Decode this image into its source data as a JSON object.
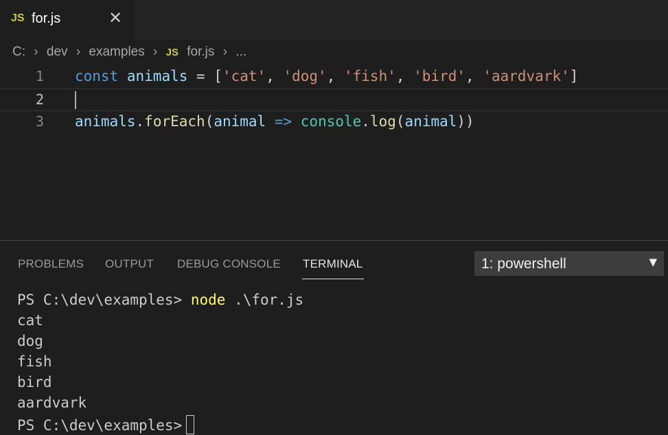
{
  "tab": {
    "badge": "JS",
    "title": "for.js",
    "close_glyph": "✕"
  },
  "breadcrumb": {
    "items": [
      "C:",
      "dev",
      "examples",
      "for.js",
      "..."
    ],
    "file_badge": "JS",
    "separator": "›"
  },
  "editor": {
    "line_numbers": [
      "1",
      "2",
      "3"
    ],
    "line1": {
      "kw": "const",
      "name": "animals",
      "eq": " = [",
      "s1": "'cat'",
      "s2": "'dog'",
      "s3": "'fish'",
      "s4": "'bird'",
      "s5": "'aardvark'",
      "comma": ", ",
      "end": "]"
    },
    "line3": {
      "obj": "animals",
      "dot": ".",
      "method": "forEach",
      "open": "(",
      "param": "animal",
      "arrow": " => ",
      "console": "console",
      "log": "log",
      "arg": "animal",
      "close": "))"
    }
  },
  "panel": {
    "tabs": [
      "PROBLEMS",
      "OUTPUT",
      "DEBUG CONSOLE",
      "TERMINAL"
    ],
    "active_tab": "TERMINAL",
    "terminal_select": {
      "value": "1: powershell",
      "arrow": "▼"
    }
  },
  "terminal": {
    "prompt": "PS C:\\dev\\examples> ",
    "command": "node",
    "args": " .\\for.js",
    "output": [
      "cat",
      "dog",
      "fish",
      "bird",
      "aardvark"
    ],
    "final_prompt": "PS C:\\dev\\examples>"
  },
  "colors": {
    "keyword": "#569cd6",
    "variable": "#9cdcfe",
    "string": "#ce9178",
    "function": "#dcdcaa",
    "class": "#4ec9b0",
    "js_badge": "#cbcb41",
    "terminal_command": "#ffff66"
  }
}
